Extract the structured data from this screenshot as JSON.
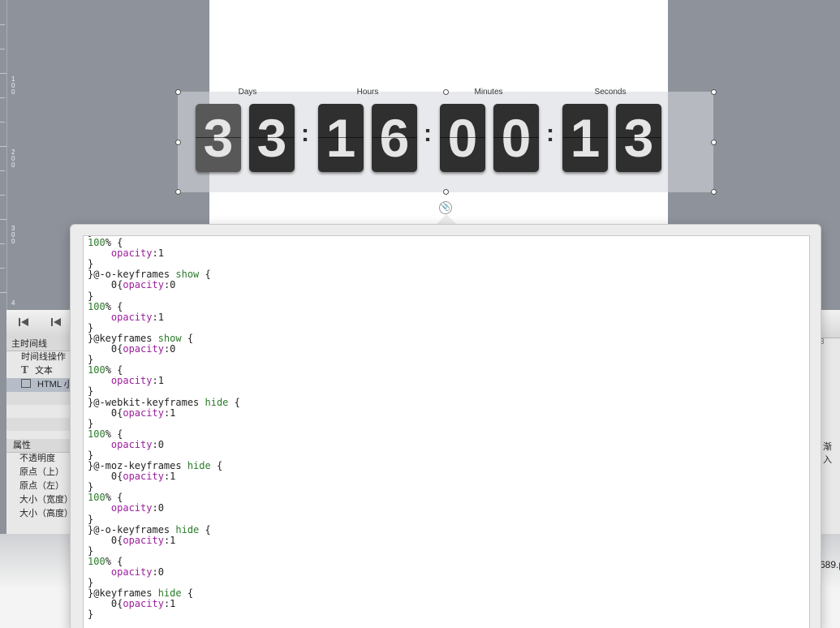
{
  "ruler": {
    "marks": [
      "100",
      "200",
      "300",
      "4"
    ]
  },
  "countdown": {
    "labels": [
      "Days",
      "Hours",
      "Minutes",
      "Seconds"
    ],
    "digits": [
      "3",
      "3",
      "1",
      "6",
      "0",
      "0",
      "1",
      "3"
    ],
    "separator": ":"
  },
  "timeline": {
    "main_label": "主时间线",
    "rows": [
      "时间线操作",
      "文本",
      "HTML 小"
    ],
    "properties_label": "属性",
    "properties": [
      "不透明度",
      "原点（上）",
      "原点（左）",
      "大小（宽度）",
      "大小（高度）"
    ],
    "right_label": "渐入",
    "right_frame": "3",
    "bottom_text": "689.p"
  },
  "editor": {
    "lines": [
      [
        {
          "t": "}"
        }
      ],
      [
        {
          "t": "100",
          "c": "num"
        },
        {
          "t": "% {"
        }
      ],
      [
        {
          "t": "    "
        },
        {
          "t": "opacity",
          "c": "prop"
        },
        {
          "t": ":1"
        }
      ],
      [
        {
          "t": "}"
        }
      ],
      [
        {
          "t": "}@-o-keyframes "
        },
        {
          "t": "show",
          "c": "kw"
        },
        {
          "t": " {"
        }
      ],
      [
        {
          "t": "    0{"
        },
        {
          "t": "opacity",
          "c": "prop"
        },
        {
          "t": ":0"
        }
      ],
      [
        {
          "t": "}"
        }
      ],
      [
        {
          "t": "100",
          "c": "num"
        },
        {
          "t": "% {"
        }
      ],
      [
        {
          "t": "    "
        },
        {
          "t": "opacity",
          "c": "prop"
        },
        {
          "t": ":1"
        }
      ],
      [
        {
          "t": "}"
        }
      ],
      [
        {
          "t": "}@keyframes "
        },
        {
          "t": "show",
          "c": "kw"
        },
        {
          "t": " {"
        }
      ],
      [
        {
          "t": "    0{"
        },
        {
          "t": "opacity",
          "c": "prop"
        },
        {
          "t": ":0"
        }
      ],
      [
        {
          "t": "}"
        }
      ],
      [
        {
          "t": "100",
          "c": "num"
        },
        {
          "t": "% {"
        }
      ],
      [
        {
          "t": "    "
        },
        {
          "t": "opacity",
          "c": "prop"
        },
        {
          "t": ":1"
        }
      ],
      [
        {
          "t": "}"
        }
      ],
      [
        {
          "t": "}@-webkit-keyframes "
        },
        {
          "t": "hide",
          "c": "kw"
        },
        {
          "t": " {"
        }
      ],
      [
        {
          "t": "    0{"
        },
        {
          "t": "opacity",
          "c": "prop"
        },
        {
          "t": ":1"
        }
      ],
      [
        {
          "t": "}"
        }
      ],
      [
        {
          "t": "100",
          "c": "num"
        },
        {
          "t": "% {"
        }
      ],
      [
        {
          "t": "    "
        },
        {
          "t": "opacity",
          "c": "prop"
        },
        {
          "t": ":0"
        }
      ],
      [
        {
          "t": "}"
        }
      ],
      [
        {
          "t": "}@-moz-keyframes "
        },
        {
          "t": "hide",
          "c": "kw"
        },
        {
          "t": " {"
        }
      ],
      [
        {
          "t": "    0{"
        },
        {
          "t": "opacity",
          "c": "prop"
        },
        {
          "t": ":1"
        }
      ],
      [
        {
          "t": "}"
        }
      ],
      [
        {
          "t": "100",
          "c": "num"
        },
        {
          "t": "% {"
        }
      ],
      [
        {
          "t": "    "
        },
        {
          "t": "opacity",
          "c": "prop"
        },
        {
          "t": ":0"
        }
      ],
      [
        {
          "t": "}"
        }
      ],
      [
        {
          "t": "}@-o-keyframes "
        },
        {
          "t": "hide",
          "c": "kw"
        },
        {
          "t": " {"
        }
      ],
      [
        {
          "t": "    0{"
        },
        {
          "t": "opacity",
          "c": "prop"
        },
        {
          "t": ":1"
        }
      ],
      [
        {
          "t": "}"
        }
      ],
      [
        {
          "t": "100",
          "c": "num"
        },
        {
          "t": "% {"
        }
      ],
      [
        {
          "t": "    "
        },
        {
          "t": "opacity",
          "c": "prop"
        },
        {
          "t": ":0"
        }
      ],
      [
        {
          "t": "}"
        }
      ],
      [
        {
          "t": "}@keyframes "
        },
        {
          "t": "hide",
          "c": "kw"
        },
        {
          "t": " {"
        }
      ],
      [
        {
          "t": "    0{"
        },
        {
          "t": "opacity",
          "c": "prop"
        },
        {
          "t": ":1"
        }
      ],
      [
        {
          "t": "}"
        }
      ]
    ]
  },
  "icons": {
    "first": "skip-to-start-icon",
    "prev": "step-back-icon",
    "pin": "paperclip-icon",
    "text_type": "text-type-icon",
    "html_widget": "html-widget-icon"
  }
}
